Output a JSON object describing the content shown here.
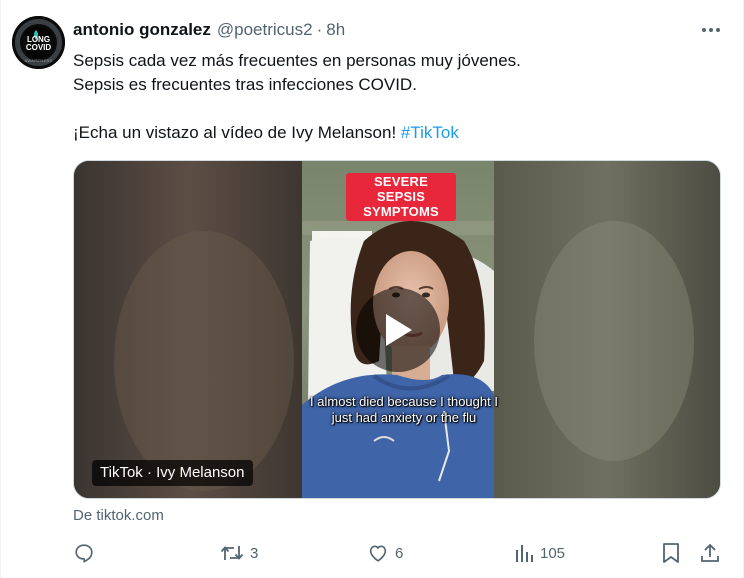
{
  "author": {
    "display_name": "antonio gonzalez",
    "handle": "@poetricus2",
    "separator": "·",
    "time": "8h",
    "avatar_text_top": "LONG",
    "avatar_text_bottom": "COVID",
    "avatar_ring_text": "AWARENESS"
  },
  "tweet": {
    "lines": [
      "Sepsis cada vez más frecuentes en personas muy jóvenes.",
      "Sepsis es frecuentes tras infecciones COVID.",
      "¡Echa un vistazo al vídeo de Ivy Melanson! "
    ],
    "hashtag": "#TikTok"
  },
  "media": {
    "overlay_title": "SEVERE SEPSIS SYMPTOMS",
    "caption": "I almost died because I thought I just had anxiety or the flu",
    "source_label": "TikTok · Ivy Melanson",
    "from_label": "De tiktok.com"
  },
  "stats": {
    "replies": "",
    "reposts": "3",
    "likes": "6",
    "views": "105"
  },
  "icons": {
    "more": "more-dots-icon",
    "reply": "reply-bubble-icon",
    "repost": "repost-arrows-icon",
    "like": "heart-icon",
    "views": "bar-chart-icon",
    "bookmark": "bookmark-icon",
    "share": "share-upload-icon",
    "play": "play-icon"
  },
  "colors": {
    "link": "#1d9bf0",
    "secondary_text": "#536471",
    "primary_text": "#0f1419",
    "overlay_red": "#e8273a"
  }
}
